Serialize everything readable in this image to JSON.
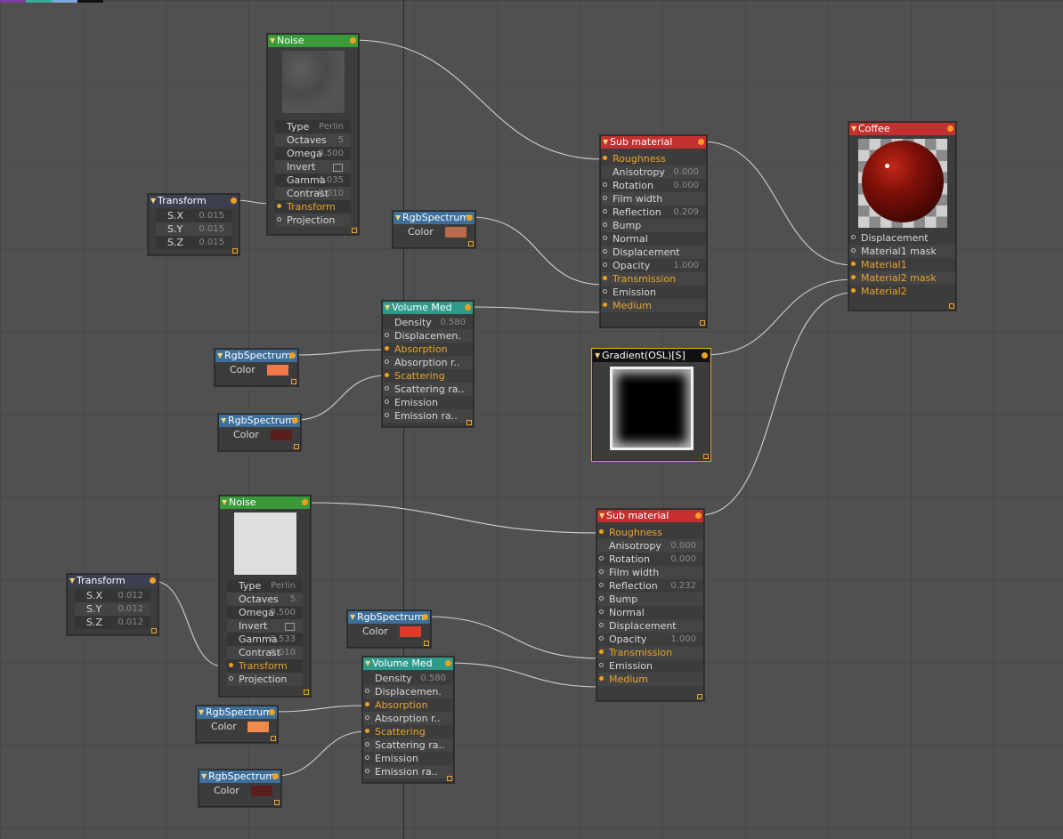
{
  "top_swatches": [
    "#7a3fa0",
    "#39a896",
    "#7ea6d8",
    "#111111"
  ],
  "nodes": {
    "noise1": {
      "title": "Noise",
      "rows": [
        {
          "label": "Type",
          "value": "Perlin"
        },
        {
          "label": "Octaves",
          "value": "5"
        },
        {
          "label": "Omega",
          "value": "0.500"
        },
        {
          "label": "Invert"
        },
        {
          "label": "Gamma",
          "value": "4.035"
        },
        {
          "label": "Contrast",
          "value": "0.010"
        },
        {
          "label": "Transform"
        },
        {
          "label": "Projection"
        }
      ]
    },
    "transform1": {
      "title": "Transform",
      "rows": [
        {
          "label": "S.X",
          "value": "0.015"
        },
        {
          "label": "S.Y",
          "value": "0.015"
        },
        {
          "label": "S.Z",
          "value": "0.015"
        }
      ]
    },
    "rgb1": {
      "title": "RgbSpectrum",
      "label": "Color",
      "color": "#b86a4a"
    },
    "volume1": {
      "title": "Volume Med",
      "rows": [
        {
          "label": "Density",
          "value": "0.580"
        },
        {
          "label": "Displacemen."
        },
        {
          "label": "Absorption"
        },
        {
          "label": "Absorption r.."
        },
        {
          "label": "Scattering"
        },
        {
          "label": "Scattering ra.."
        },
        {
          "label": "Emission"
        },
        {
          "label": "Emission ra.."
        }
      ]
    },
    "rgb2": {
      "title": "RgbSpectrum",
      "label": "Color",
      "color": "#f07a4a"
    },
    "rgb3": {
      "title": "RgbSpectrum",
      "label": "Color",
      "color": "#5a1e1e"
    },
    "sub1": {
      "title": "Sub material",
      "rows": [
        {
          "label": "Roughness"
        },
        {
          "label": "Anisotropy",
          "value": "0.000"
        },
        {
          "label": "Rotation",
          "value": "0.000"
        },
        {
          "label": "Film width"
        },
        {
          "label": "Reflection",
          "value": "0.209"
        },
        {
          "label": "Bump"
        },
        {
          "label": "Normal"
        },
        {
          "label": "Displacement"
        },
        {
          "label": "Opacity",
          "value": "1.000"
        },
        {
          "label": "Transmission"
        },
        {
          "label": "Emission"
        },
        {
          "label": "Medium"
        }
      ]
    },
    "coffee": {
      "title": "Coffee",
      "rows": [
        {
          "label": "Displacement"
        },
        {
          "label": "Material1 mask"
        },
        {
          "label": "Material1"
        },
        {
          "label": "Material2 mask"
        },
        {
          "label": "Material2"
        }
      ]
    },
    "gradient": {
      "title": "Gradient(OSL)[S]"
    },
    "noise2": {
      "title": "Noise",
      "rows": [
        {
          "label": "Type",
          "value": "Perlin"
        },
        {
          "label": "Octaves",
          "value": "5"
        },
        {
          "label": "Omega",
          "value": "0.500"
        },
        {
          "label": "Invert"
        },
        {
          "label": "Gamma",
          "value": "0.533"
        },
        {
          "label": "Contrast",
          "value": "0.010"
        },
        {
          "label": "Transform"
        },
        {
          "label": "Projection"
        }
      ]
    },
    "transform2": {
      "title": "Transform",
      "rows": [
        {
          "label": "S.X",
          "value": "0.012"
        },
        {
          "label": "S.Y",
          "value": "0.012"
        },
        {
          "label": "S.Z",
          "value": "0.012"
        }
      ]
    },
    "sub2": {
      "title": "Sub material",
      "rows": [
        {
          "label": "Roughness"
        },
        {
          "label": "Anisotropy",
          "value": "0.000"
        },
        {
          "label": "Rotation",
          "value": "0.000"
        },
        {
          "label": "Film width"
        },
        {
          "label": "Reflection",
          "value": "0.232"
        },
        {
          "label": "Bump"
        },
        {
          "label": "Normal"
        },
        {
          "label": "Displacement"
        },
        {
          "label": "Opacity",
          "value": "1.000"
        },
        {
          "label": "Transmission"
        },
        {
          "label": "Emission"
        },
        {
          "label": "Medium"
        }
      ]
    },
    "rgb4": {
      "title": "RgbSpectrum",
      "label": "Color",
      "color": "#e03a2a"
    },
    "volume2": {
      "title": "Volume Med",
      "rows": [
        {
          "label": "Density",
          "value": "0.580"
        },
        {
          "label": "Displacemen."
        },
        {
          "label": "Absorption"
        },
        {
          "label": "Absorption r.."
        },
        {
          "label": "Scattering"
        },
        {
          "label": "Scattering ra.."
        },
        {
          "label": "Emission"
        },
        {
          "label": "Emission ra.."
        }
      ]
    },
    "rgb5": {
      "title": "RgbSpectrum",
      "label": "Color",
      "color": "#f08a4a"
    },
    "rgb6": {
      "title": "RgbSpectrum",
      "label": "Color",
      "color": "#5a1e1e"
    }
  }
}
